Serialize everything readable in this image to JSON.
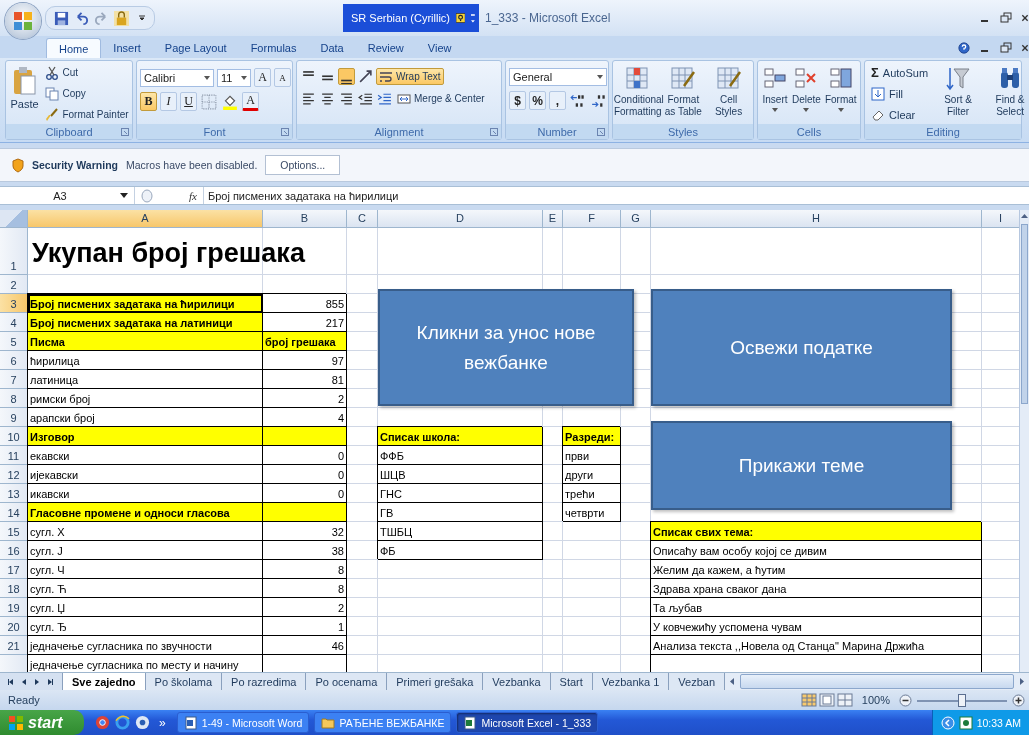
{
  "window": {
    "title": "1_333 - Microsoft Excel",
    "language": "SR Serbian (Cyrillic)"
  },
  "ribbon_tabs": [
    {
      "label": "Home",
      "selected": true
    },
    {
      "label": "Insert",
      "selected": false
    },
    {
      "label": "Page Layout",
      "selected": false
    },
    {
      "label": "Formulas",
      "selected": false
    },
    {
      "label": "Data",
      "selected": false
    },
    {
      "label": "Review",
      "selected": false
    },
    {
      "label": "View",
      "selected": false
    }
  ],
  "ribbon": {
    "clipboard": {
      "label": "Clipboard",
      "paste": "Paste",
      "cut": "Cut",
      "copy": "Copy",
      "format_painter": "Format Painter"
    },
    "font": {
      "label": "Font",
      "font_name": "Calibri",
      "font_size": "11",
      "grow": "A",
      "shrink": "A",
      "bold": {
        "text": "B",
        "on": true
      },
      "italic": {
        "text": "I",
        "on": false
      },
      "underline": {
        "text": "U",
        "on": false
      },
      "font_color": "A"
    },
    "alignment": {
      "label": "Alignment",
      "vertical": [
        {
          "selected": false
        },
        {
          "selected": false
        },
        {
          "selected": true
        }
      ],
      "wrap_text": {
        "label": "Wrap Text",
        "on": true
      },
      "merge_center": "Merge & Center"
    },
    "number": {
      "label": "Number",
      "format": "General",
      "currency": "$",
      "percent": "%",
      "comma": ","
    },
    "styles": {
      "label": "Styles",
      "buttons": [
        {
          "label": "Conditional Formatting"
        },
        {
          "label": "Format as Table"
        },
        {
          "label": "Cell Styles"
        }
      ]
    },
    "cells": {
      "label": "Cells",
      "buttons": [
        {
          "label": "Insert"
        },
        {
          "label": "Delete"
        },
        {
          "label": "Format"
        }
      ]
    },
    "editing": {
      "label": "Editing",
      "sigma": "Σ",
      "autosum": "AutoSum",
      "fill": "Fill",
      "clear": "Clear",
      "sort_filter": "Sort & Filter",
      "find_select": "Find & Select"
    }
  },
  "security_bar": {
    "title": "Security Warning",
    "message": "Macros have been disabled.",
    "button": "Options..."
  },
  "formula_bar": {
    "name_box": "A3",
    "function_label": "fx",
    "formula": "Број писмених задатака на ћирилици"
  },
  "sheet": {
    "columns": [
      {
        "label": "A",
        "selected": true
      },
      {
        "label": "B",
        "selected": false
      },
      {
        "label": "C",
        "selected": false
      },
      {
        "label": "D",
        "selected": false
      },
      {
        "label": "E",
        "selected": false
      },
      {
        "label": "F",
        "selected": false
      },
      {
        "label": "G",
        "selected": false
      },
      {
        "label": "H",
        "selected": false
      },
      {
        "label": "I",
        "selected": false
      }
    ],
    "rows": [
      {
        "number": "1",
        "selected": false,
        "cells": [
          {
            "kind": "title",
            "text": "Укупан број грешака"
          }
        ]
      },
      {
        "number": "2",
        "selected": false
      },
      {
        "number": "3",
        "selected": true,
        "cells": [
          {
            "kind": "heading",
            "text": "Број писмених задатака на ћирилици"
          },
          {
            "kind": "number",
            "text": "855"
          }
        ]
      },
      {
        "number": "4",
        "selected": false,
        "cells": [
          {
            "kind": "heading",
            "text": "Број писмених задатака на латиници"
          },
          {
            "kind": "number",
            "text": "217"
          }
        ]
      },
      {
        "number": "5",
        "selected": false,
        "cells": [
          {
            "kind": "heading",
            "text": "Писма"
          },
          {
            "kind": "heading",
            "text": "број грешака"
          }
        ]
      },
      {
        "number": "6",
        "selected": false,
        "cells": [
          {
            "kind": "text",
            "text": "ћирилица"
          },
          {
            "kind": "number",
            "text": "97"
          }
        ]
      },
      {
        "number": "7",
        "selected": false,
        "cells": [
          {
            "kind": "text",
            "text": "латиница"
          },
          {
            "kind": "number",
            "text": "81"
          }
        ]
      },
      {
        "number": "8",
        "selected": false,
        "cells": [
          {
            "kind": "text",
            "text": "римски број"
          },
          {
            "kind": "number",
            "text": "2"
          }
        ]
      },
      {
        "number": "9",
        "selected": false,
        "cells": [
          {
            "kind": "text",
            "text": "арапски број"
          },
          {
            "kind": "number",
            "text": "4"
          }
        ]
      },
      {
        "number": "10",
        "selected": false,
        "cells": [
          {
            "kind": "heading",
            "text": "Изговор"
          },
          {
            "kind": "heading"
          },
          null,
          {
            "kind": "heading",
            "text": "Списак школа:"
          },
          null,
          {
            "kind": "heading",
            "text": "Разреди:"
          }
        ]
      },
      {
        "number": "11",
        "selected": false,
        "cells": [
          {
            "kind": "text",
            "text": "екавски"
          },
          {
            "kind": "number",
            "text": "0"
          },
          null,
          {
            "kind": "text",
            "text": "ФФБ"
          },
          null,
          {
            "kind": "text",
            "text": "први"
          }
        ]
      },
      {
        "number": "12",
        "selected": false,
        "cells": [
          {
            "kind": "text",
            "text": "ијекавски"
          },
          {
            "kind": "number",
            "text": "0"
          },
          null,
          {
            "kind": "text",
            "text": "ШЦВ"
          },
          null,
          {
            "kind": "text",
            "text": "други"
          }
        ]
      },
      {
        "number": "13",
        "selected": false,
        "cells": [
          {
            "kind": "text",
            "text": "икавски"
          },
          {
            "kind": "number",
            "text": "0"
          },
          null,
          {
            "kind": "text",
            "text": "ГНС"
          },
          null,
          {
            "kind": "text",
            "text": "трећи"
          }
        ]
      },
      {
        "number": "14",
        "selected": false,
        "cells": [
          {
            "kind": "heading",
            "text": "Гласовне промене и односи гласова"
          },
          {
            "kind": "heading"
          },
          null,
          {
            "kind": "text",
            "text": "ГВ"
          },
          null,
          {
            "kind": "text",
            "text": "четврти"
          }
        ]
      },
      {
        "number": "15",
        "selected": false,
        "cells": [
          {
            "kind": "text",
            "text": "сугл. Х"
          },
          {
            "kind": "number",
            "text": "32"
          },
          null,
          {
            "kind": "text",
            "text": "ТШБЦ"
          },
          null,
          null,
          null,
          {
            "kind": "heading",
            "text": "Списак свих тема:"
          }
        ]
      },
      {
        "number": "16",
        "selected": false,
        "cells": [
          {
            "kind": "text",
            "text": "сугл. Ј"
          },
          {
            "kind": "number",
            "text": "38"
          },
          null,
          {
            "kind": "text",
            "text": "ФБ"
          },
          null,
          null,
          null,
          {
            "kind": "text",
            "text": "Описаћу вам особу којој се дивим"
          }
        ]
      },
      {
        "number": "17",
        "selected": false,
        "cells": [
          {
            "kind": "text",
            "text": "сугл. Ч"
          },
          {
            "kind": "number",
            "text": "8"
          },
          null,
          null,
          null,
          null,
          null,
          {
            "kind": "text",
            "text": "Желим да кажем, а ћутим"
          }
        ]
      },
      {
        "number": "18",
        "selected": false,
        "cells": [
          {
            "kind": "text",
            "text": "сугл. Ћ"
          },
          {
            "kind": "number",
            "text": "8"
          },
          null,
          null,
          null,
          null,
          null,
          {
            "kind": "text",
            "text": "Здрава храна сваког дана"
          }
        ]
      },
      {
        "number": "19",
        "selected": false,
        "cells": [
          {
            "kind": "text",
            "text": "сугл. Џ"
          },
          {
            "kind": "number",
            "text": "2"
          },
          null,
          null,
          null,
          null,
          null,
          {
            "kind": "text",
            "text": "Та љубав"
          }
        ]
      },
      {
        "number": "20",
        "selected": false,
        "cells": [
          {
            "kind": "text",
            "text": "сугл. Ђ"
          },
          {
            "kind": "number",
            "text": "1"
          },
          null,
          null,
          null,
          null,
          null,
          {
            "kind": "text",
            "text": "У ковчежићу успомена чувам"
          }
        ]
      },
      {
        "number": "21",
        "selected": false,
        "cells": [
          {
            "kind": "text",
            "text": "једначење сугласника по звучности"
          },
          {
            "kind": "number",
            "text": "46"
          },
          null,
          null,
          null,
          null,
          null,
          {
            "kind": "text",
            "text": "Анализа текста ,,Новела од Станца\" Марина Држића"
          }
        ]
      },
      {
        "selected": false,
        "cells": [
          {
            "kind": "text",
            "text": "једначење сугласника по месту и начину"
          },
          {
            "kind": "text"
          },
          null,
          null,
          null,
          null,
          null,
          {
            "kind": "text"
          }
        ]
      }
    ]
  },
  "shapes": [
    {
      "label": "Кликни за унос нове вежбанке"
    },
    {
      "label": "Освежи податке"
    },
    {
      "label": "Прикажи теме"
    }
  ],
  "sheet_tabs": [
    {
      "label": "Sve zajedno",
      "selected": true
    },
    {
      "label": "Po školama",
      "selected": false
    },
    {
      "label": "Po razredima",
      "selected": false
    },
    {
      "label": "Po ocenama",
      "selected": false
    },
    {
      "label": "Primeri grešaka",
      "selected": false
    },
    {
      "label": "Vezbanka",
      "selected": false
    },
    {
      "label": "Start",
      "selected": false
    },
    {
      "label": "Vezbanka 1",
      "selected": false
    },
    {
      "label": "Vezban",
      "selected": false
    }
  ],
  "status_bar": {
    "text": "Ready",
    "views": [
      {
        "selected": true
      },
      {
        "selected": false
      },
      {
        "selected": false
      }
    ],
    "zoom": "100%",
    "zoom_slider": {
      "level": 0.5
    }
  },
  "taskbar": {
    "start": "start",
    "overflow": "»",
    "tasks": [
      {
        "label": "1-49 - Microsoft Word",
        "selected": false
      },
      {
        "label": "РАЂЕНЕ ВЕЖБАНКЕ",
        "selected": false
      },
      {
        "label": "Microsoft Excel - 1_333",
        "selected": true
      }
    ],
    "clock": "10:33 AM"
  }
}
